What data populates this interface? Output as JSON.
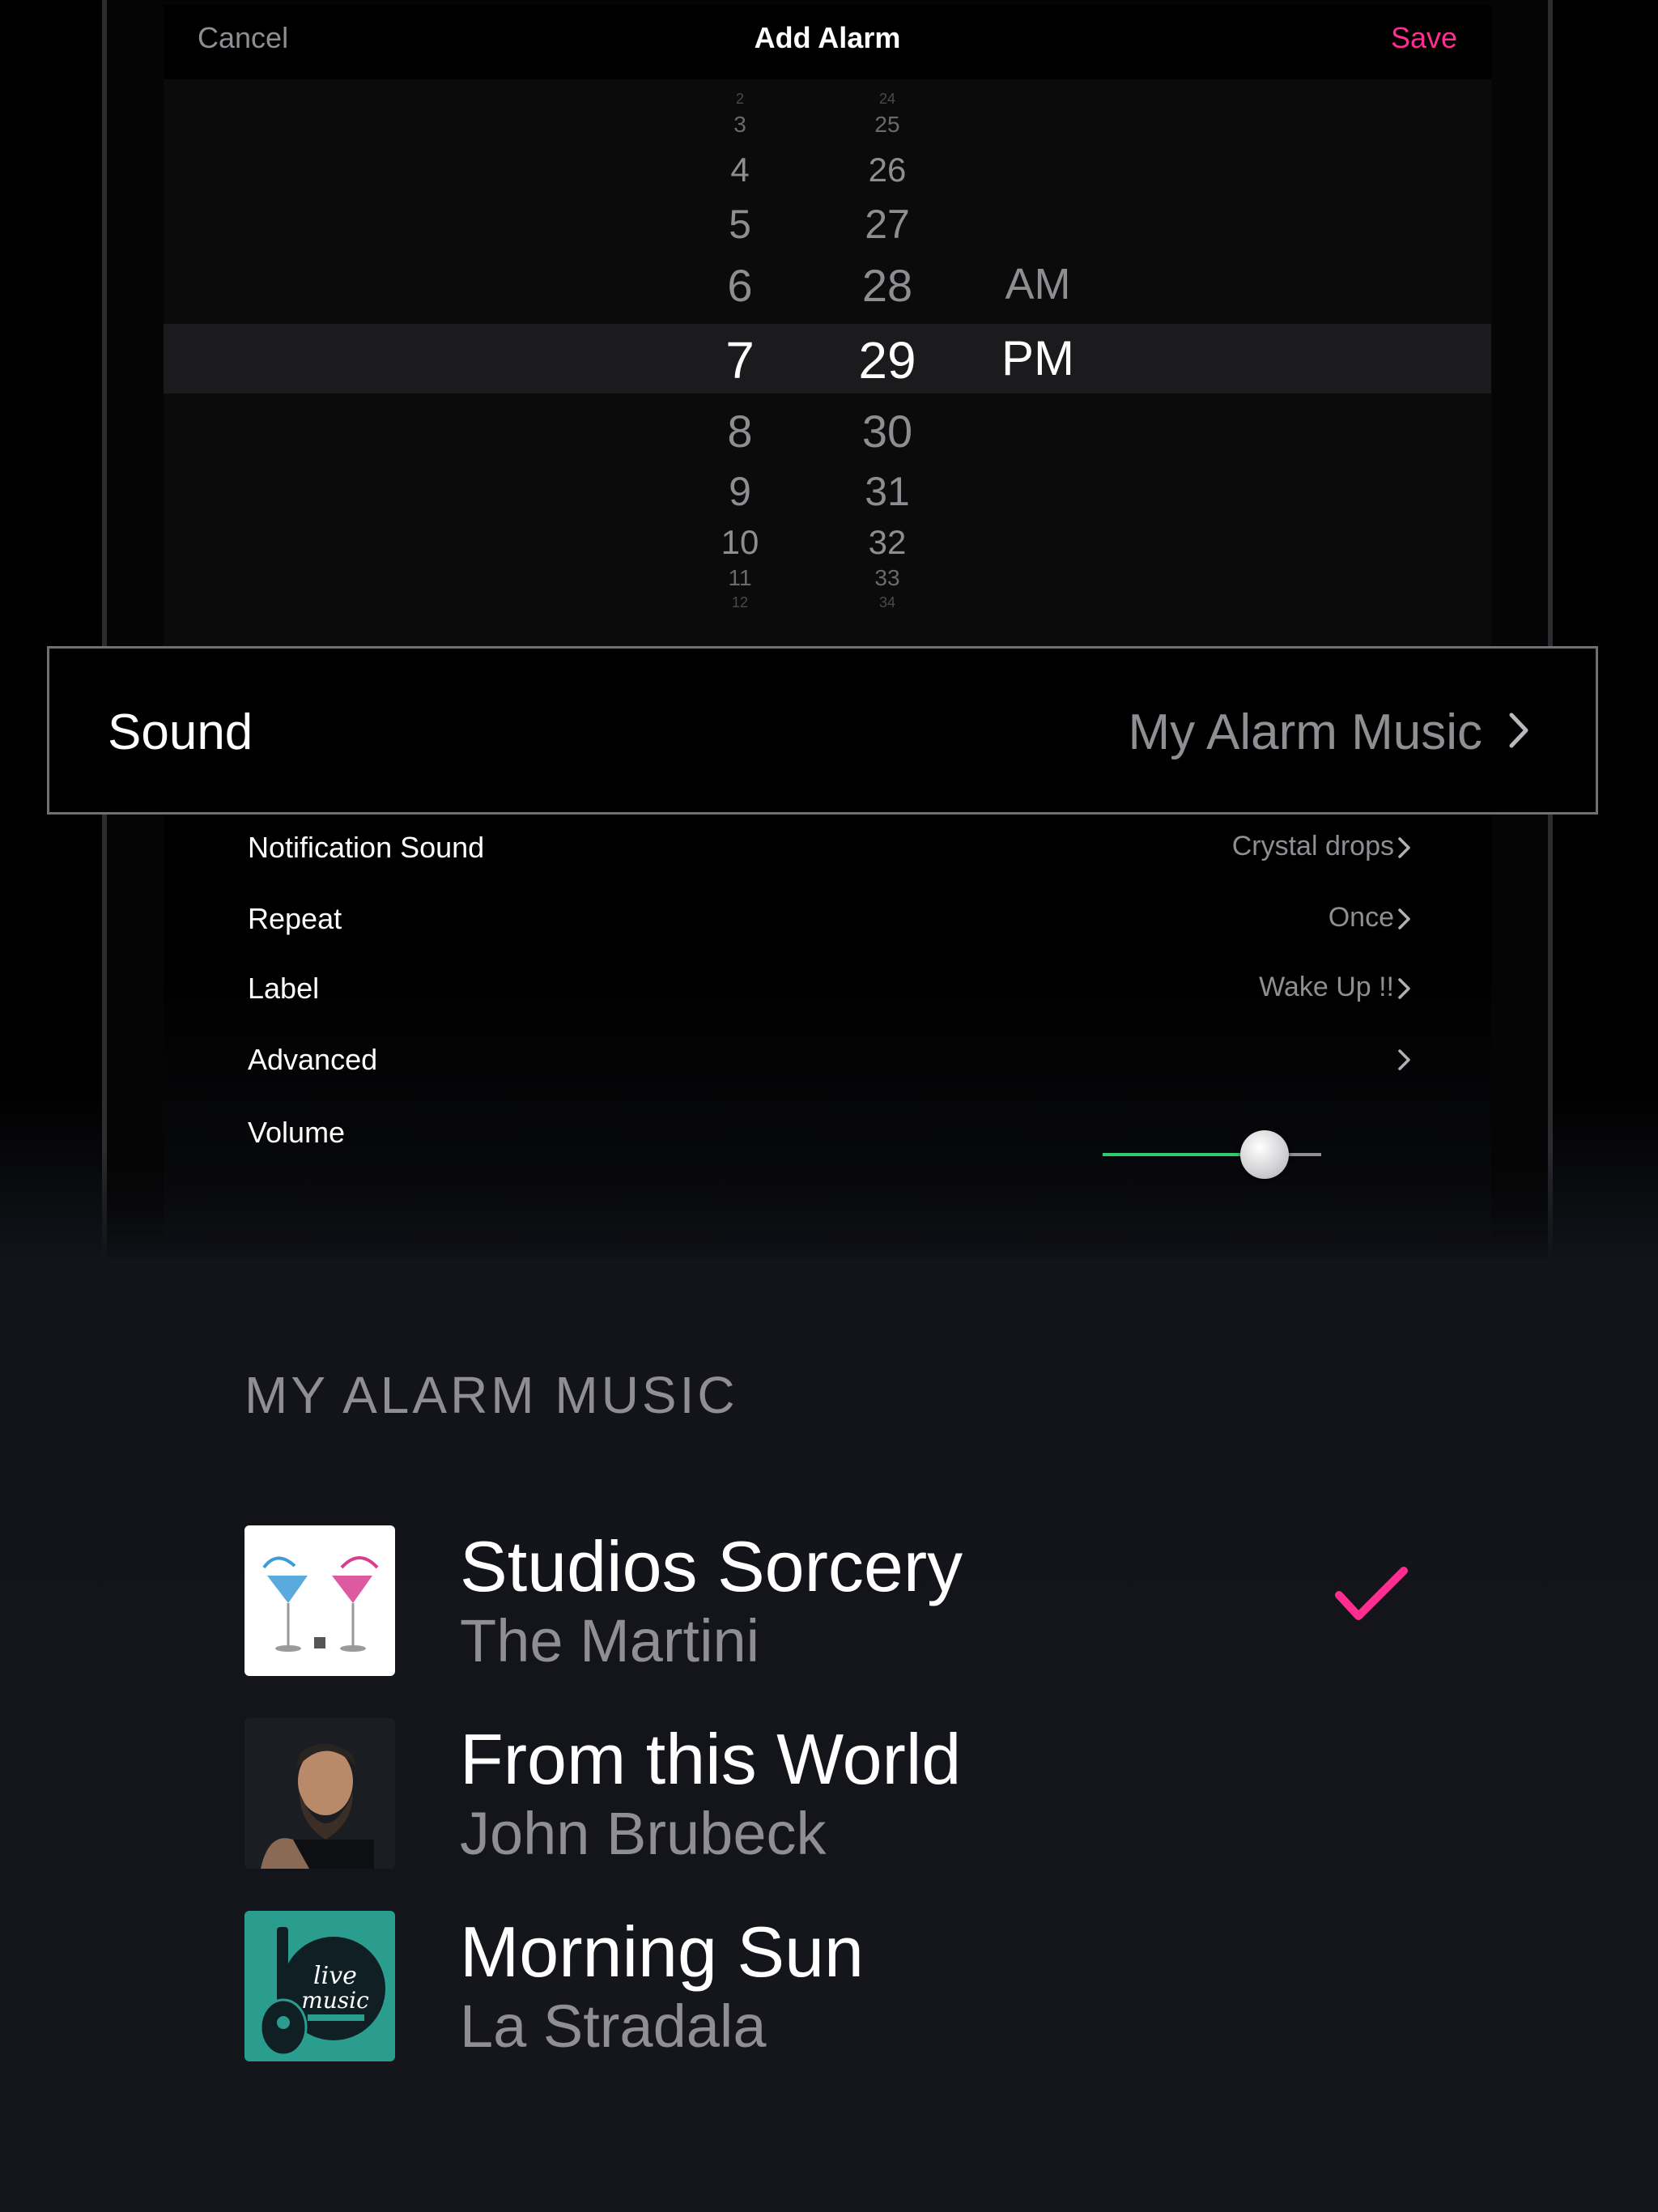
{
  "nav": {
    "cancel_label": "Cancel",
    "title": "Add Alarm",
    "save_label": "Save"
  },
  "picker": {
    "hours": [
      "2",
      "3",
      "4",
      "5",
      "6",
      "7",
      "8",
      "9",
      "10",
      "11",
      "12"
    ],
    "minutes": [
      "24",
      "25",
      "26",
      "27",
      "28",
      "29",
      "30",
      "31",
      "32",
      "33",
      "34"
    ],
    "periods": [
      "AM",
      "PM"
    ],
    "selected": {
      "hour": "7",
      "minute": "29",
      "period": "PM"
    }
  },
  "sound": {
    "label": "Sound",
    "value": "My Alarm Music"
  },
  "settings": {
    "notification_sound": {
      "label": "Notification Sound",
      "value": "Crystal drops"
    },
    "repeat": {
      "label": "Repeat",
      "value": "Once"
    },
    "label": {
      "label": "Label",
      "value": "Wake Up !!"
    },
    "advanced": {
      "label": "Advanced"
    },
    "volume": {
      "label": "Volume",
      "level": 0.74
    }
  },
  "music": {
    "section_title": "MY ALARM MUSIC",
    "tracks": [
      {
        "title": "Studios Sorcery",
        "artist": "The Martini",
        "selected": true
      },
      {
        "title": "From this World",
        "artist": "John Brubeck",
        "selected": false
      },
      {
        "title": "Morning Sun",
        "artist": "La Stradala",
        "selected": false
      }
    ],
    "art3_text": "live music"
  },
  "colors": {
    "accent": "#ff2d8f",
    "slider_on": "#2ecc71",
    "secondary_text": "#8e8e93",
    "art3_bg": "#2a9d8f"
  },
  "icons": {
    "row_chevron": "chevron-right-icon",
    "selected_mark": "checkmark-icon"
  }
}
